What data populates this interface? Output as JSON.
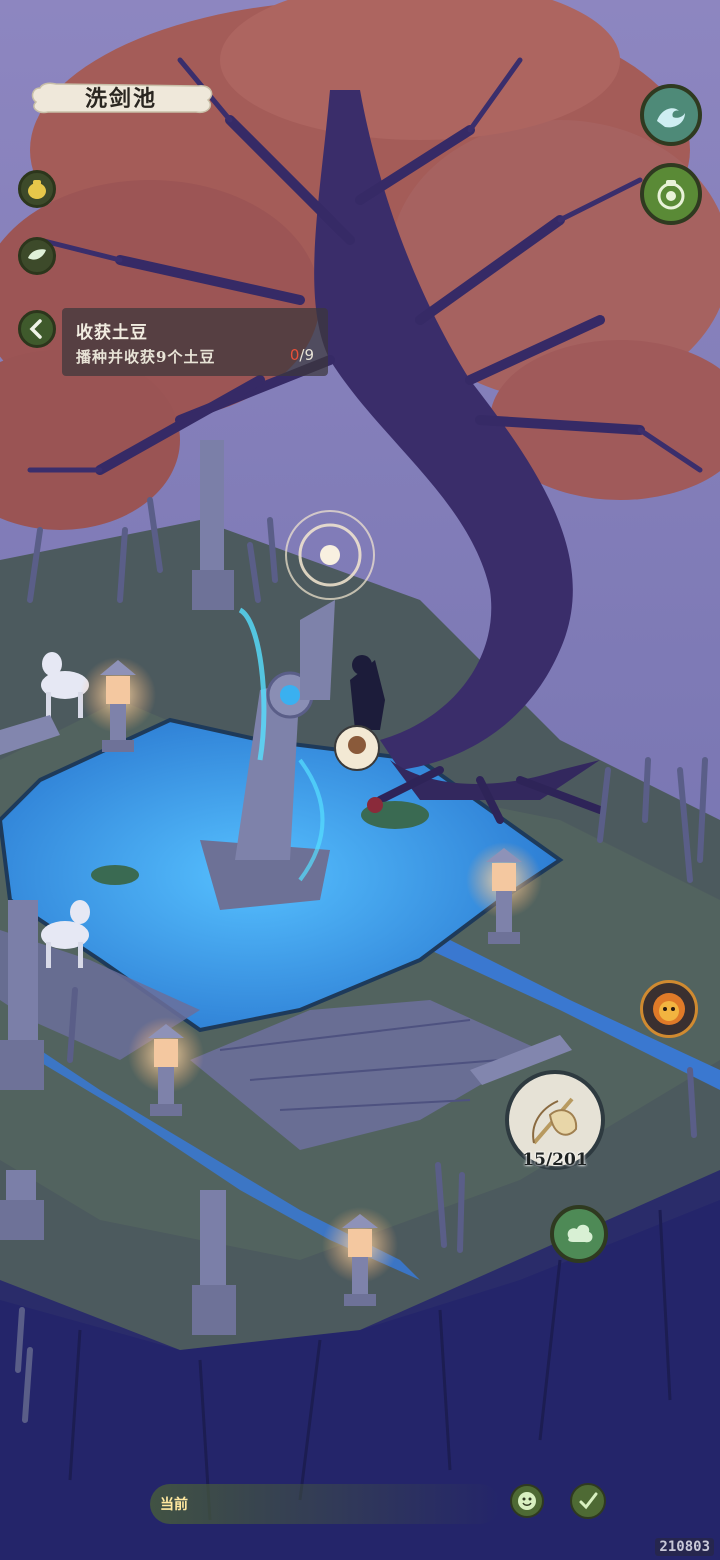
{
  "location": {
    "name": "洗剑池"
  },
  "quest": {
    "title": "收获土豆",
    "description": "播种并收获9个土豆",
    "progress_current": "0",
    "progress_total": "/9"
  },
  "tool": {
    "count": "15/201"
  },
  "chat": {
    "channel_label": "当前"
  },
  "version": "210803",
  "left_buttons": [
    {
      "icon": "gourd-pot-icon"
    },
    {
      "icon": "leaf-icon"
    },
    {
      "icon": "back-arrow-icon"
    }
  ],
  "right_buttons": [
    {
      "icon": "wave-icon"
    },
    {
      "icon": "jar-icon"
    },
    {
      "icon": "lion-mask-icon"
    },
    {
      "icon": "bow-net-tool-icon"
    },
    {
      "icon": "cloud-swirl-icon"
    }
  ],
  "colors": {
    "water": "#3fa0e6",
    "grass": "#4a5a58",
    "foliage": "#a05a55",
    "sky": "#8c8cc0",
    "ui_green": "#3d4a2a"
  }
}
